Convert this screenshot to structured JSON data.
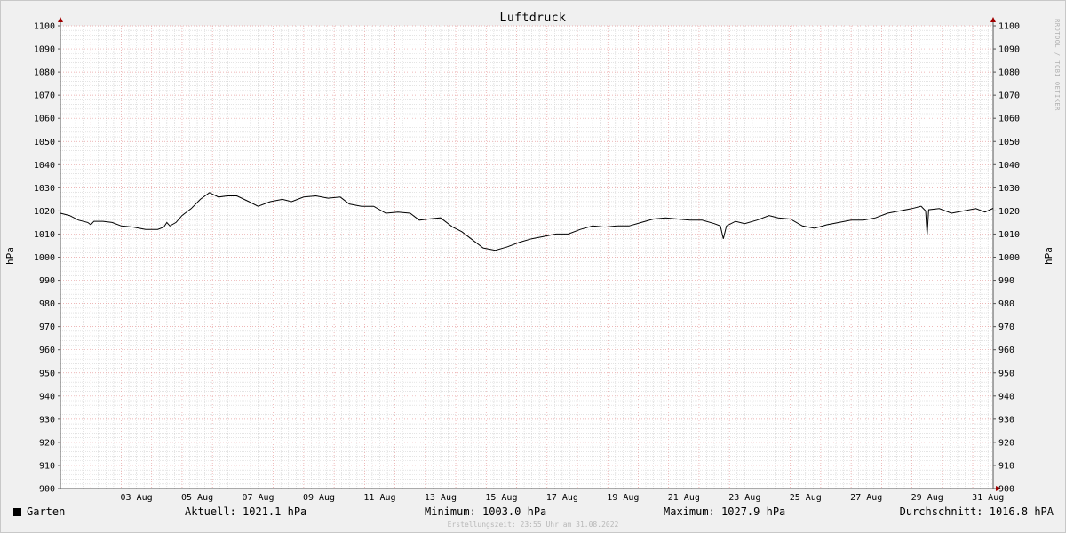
{
  "chart_data": {
    "type": "line",
    "title": "Luftdruck",
    "ylabel_left": "hPa",
    "ylabel_right": "hPa",
    "ylim": [
      900,
      1100
    ],
    "y_ticks": [
      900,
      910,
      920,
      930,
      940,
      950,
      960,
      970,
      980,
      990,
      1000,
      1010,
      1020,
      1030,
      1040,
      1050,
      1060,
      1070,
      1080,
      1090,
      1100
    ],
    "xlim_days": [
      1,
      31.67
    ],
    "x_ticks": [
      {
        "day": 3,
        "label": "03 Aug"
      },
      {
        "day": 5,
        "label": "05 Aug"
      },
      {
        "day": 7,
        "label": "07 Aug"
      },
      {
        "day": 9,
        "label": "09 Aug"
      },
      {
        "day": 11,
        "label": "11 Aug"
      },
      {
        "day": 13,
        "label": "13 Aug"
      },
      {
        "day": 15,
        "label": "15 Aug"
      },
      {
        "day": 17,
        "label": "17 Aug"
      },
      {
        "day": 19,
        "label": "19 Aug"
      },
      {
        "day": 21,
        "label": "21 Aug"
      },
      {
        "day": 23,
        "label": "23 Aug"
      },
      {
        "day": 25,
        "label": "25 Aug"
      },
      {
        "day": 27,
        "label": "27 Aug"
      },
      {
        "day": 29,
        "label": "29 Aug"
      },
      {
        "day": 31,
        "label": "31 Aug"
      }
    ],
    "grid": true,
    "colors": {
      "background": "#f0f0f0",
      "plot_background": "#ffffff",
      "major_grid": "#e8a0a0",
      "minor_grid": "#d4d4d4",
      "axis_arrow": "#a00000",
      "line": "#000000"
    },
    "series": [
      {
        "name": "Garten",
        "x": [
          1.0,
          1.3,
          1.6,
          1.9,
          2.0,
          2.1,
          2.4,
          2.7,
          3.0,
          3.4,
          3.8,
          4.2,
          4.4,
          4.5,
          4.6,
          4.8,
          5.0,
          5.3,
          5.6,
          5.9,
          6.2,
          6.5,
          6.8,
          7.2,
          7.5,
          7.9,
          8.3,
          8.6,
          9.0,
          9.4,
          9.8,
          10.2,
          10.5,
          10.9,
          11.3,
          11.7,
          12.1,
          12.5,
          12.8,
          13.1,
          13.5,
          13.9,
          14.2,
          14.6,
          14.9,
          15.3,
          15.7,
          16.1,
          16.5,
          16.9,
          17.3,
          17.7,
          18.1,
          18.5,
          18.9,
          19.3,
          19.7,
          20.1,
          20.5,
          20.9,
          21.3,
          21.7,
          22.1,
          22.5,
          22.7,
          22.8,
          22.9,
          23.2,
          23.5,
          23.9,
          24.3,
          24.6,
          25.0,
          25.4,
          25.8,
          26.2,
          26.6,
          27.0,
          27.4,
          27.8,
          28.2,
          28.6,
          29.0,
          29.3,
          29.45,
          29.5,
          29.55,
          29.9,
          30.3,
          30.7,
          31.1,
          31.4,
          31.67
        ],
        "values": [
          1019.0,
          1018.0,
          1016.0,
          1015.0,
          1014.0,
          1015.5,
          1015.5,
          1015.0,
          1013.5,
          1013.0,
          1012.0,
          1012.0,
          1013.0,
          1015.0,
          1013.5,
          1015.0,
          1018.0,
          1021.0,
          1025.0,
          1027.9,
          1026.0,
          1026.5,
          1026.5,
          1024.0,
          1022.0,
          1024.0,
          1025.0,
          1024.0,
          1026.0,
          1026.5,
          1025.5,
          1026.0,
          1023.0,
          1022.0,
          1022.0,
          1019.0,
          1019.5,
          1019.0,
          1016.0,
          1016.5,
          1017.0,
          1013.0,
          1011.0,
          1007.0,
          1004.0,
          1003.0,
          1004.5,
          1006.5,
          1008.0,
          1009.0,
          1010.0,
          1010.0,
          1012.0,
          1013.5,
          1013.0,
          1013.5,
          1013.5,
          1015.0,
          1016.5,
          1017.0,
          1016.5,
          1016.0,
          1016.0,
          1014.5,
          1013.5,
          1008.0,
          1013.5,
          1015.5,
          1014.5,
          1016.0,
          1018.0,
          1017.0,
          1016.5,
          1013.5,
          1012.5,
          1014.0,
          1015.0,
          1016.0,
          1016.0,
          1017.0,
          1019.0,
          1020.0,
          1021.0,
          1022.0,
          1020.0,
          1009.5,
          1020.5,
          1021.0,
          1019.0,
          1020.0,
          1021.0,
          1019.5,
          1021.1
        ]
      }
    ]
  },
  "watermark": "RRDTOOL / TOBI OETIKER",
  "legend": {
    "series_name": "Garten",
    "current": "Aktuell: 1021.1 hPa",
    "minimum": "Minimum: 1003.0 hPa",
    "maximum": "Maximum: 1027.9 hPa",
    "average": "Durchschnitt: 1016.8 hPA"
  },
  "footer": "Erstellungszeit: 23:55 Uhr am 31.08.2022"
}
